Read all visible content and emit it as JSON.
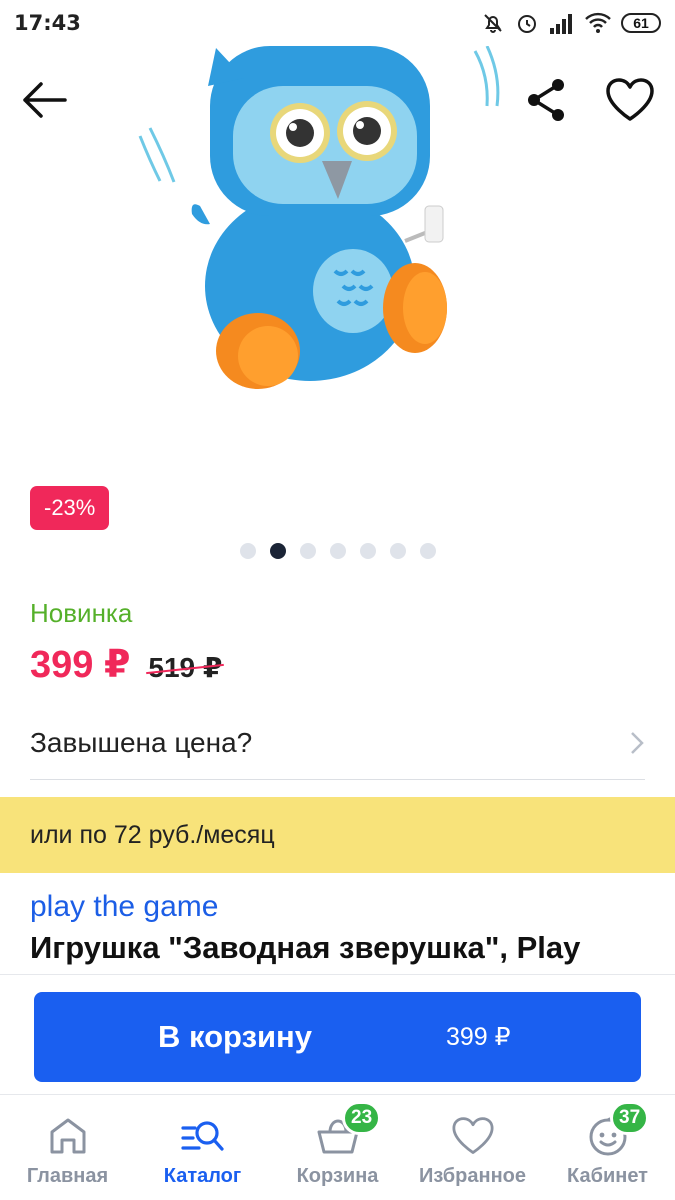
{
  "status_bar": {
    "time": "17:43",
    "battery": "61"
  },
  "product": {
    "discount": "-23%",
    "image_count": 7,
    "active_image_index": 1,
    "new_label": "Новинка",
    "price_current": "399 ₽",
    "price_old": "519 ₽",
    "overprice_question": "Завышена цена?",
    "installment": "или по 72 руб./месяц",
    "brand": "play the game",
    "title": "Игрушка \"Заводная зверушка\", Play"
  },
  "cart_button": {
    "label": "В корзину",
    "price": "399 ₽"
  },
  "bottom_nav": {
    "items": [
      {
        "label": "Главная",
        "icon": "home-icon",
        "active": false
      },
      {
        "label": "Каталог",
        "icon": "catalog-search-icon",
        "active": true
      },
      {
        "label": "Корзина",
        "icon": "basket-icon",
        "badge": "23"
      },
      {
        "label": "Избранное",
        "icon": "heart-icon"
      },
      {
        "label": "Кабинет",
        "icon": "smiley-icon",
        "badge": "37"
      }
    ]
  },
  "colors": {
    "accent": "#1a5ff0",
    "sale": "#f0285a",
    "new": "#55b02a",
    "installment_bg": "#f8e37a",
    "badge": "#35b546"
  }
}
